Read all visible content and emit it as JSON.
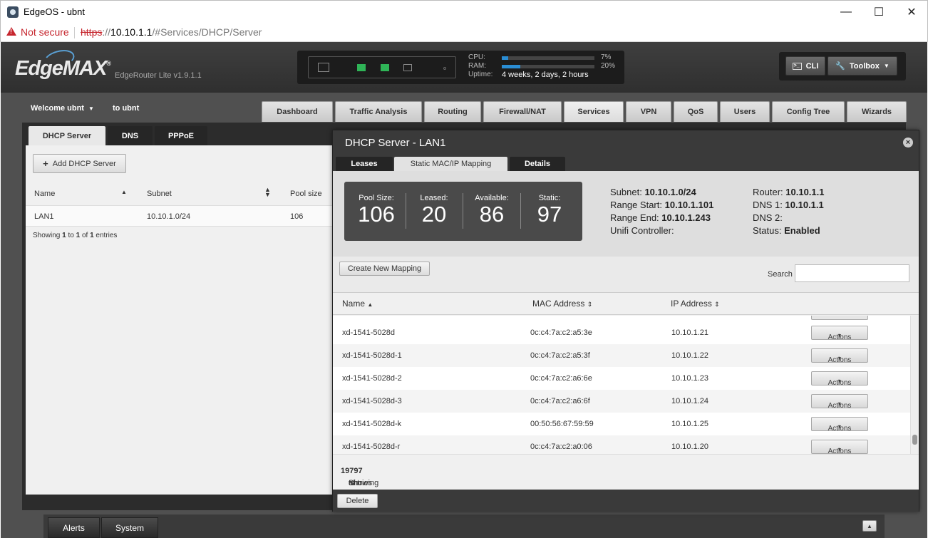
{
  "browser": {
    "window_title": "EdgeOS - ubnt",
    "security_label": "Not secure",
    "url_scheme": "https",
    "url_sep": "://",
    "url_host": "10.10.1.1",
    "url_path": "/#Services/DHCP/Server"
  },
  "header": {
    "logo_text": "EdgeMAX",
    "logo_mark": "®",
    "model": "EdgeRouter Lite v1.9.1.1",
    "cpu_label": "CPU:",
    "cpu_pct": "7%",
    "cpu_value": 7,
    "ram_label": "RAM:",
    "ram_pct": "20%",
    "ram_value": 20,
    "uptime_label": "Uptime:",
    "uptime_value": "4 weeks, 2 days, 2 hours",
    "cli_label": "CLI",
    "toolbox_label": "Toolbox"
  },
  "user": {
    "welcome": "Welcome ubnt",
    "to_ubnt": "to ubnt"
  },
  "nav_tabs": [
    "Dashboard",
    "Traffic Analysis",
    "Routing",
    "Firewall/NAT",
    "Services",
    "VPN",
    "QoS",
    "Users",
    "Config Tree",
    "Wizards"
  ],
  "nav_active": "Services",
  "left": {
    "tabs": [
      "DHCP Server",
      "DNS",
      "PPPoE"
    ],
    "add_button": "Add DHCP Server",
    "col_name": "Name",
    "col_subnet": "Subnet",
    "col_pool": "Pool size",
    "row_name": "LAN1",
    "row_subnet": "10.10.1.0/24",
    "row_pool": "106",
    "info_prefix": "Showing ",
    "info_from": "1",
    "info_to_word": " to ",
    "info_to": "1",
    "info_of_word": " of ",
    "info_total": "1",
    "info_suffix": " entries"
  },
  "modal": {
    "title": "DHCP Server - LAN1",
    "close_glyph": "×",
    "tabs": [
      "Leases",
      "Static MAC/IP Mapping",
      "Details"
    ],
    "active_tab": "Static MAC/IP Mapping",
    "pool_label": "Pool Size:",
    "pool_value": "106",
    "leased_label": "Leased:",
    "leased_value": "20",
    "available_label": "Available:",
    "available_value": "86",
    "static_label": "Static:",
    "static_value": "97",
    "subnet_label": "Subnet:",
    "subnet_value": "10.10.1.0/24",
    "range_start_label": "Range Start:",
    "range_start_value": "10.10.1.101",
    "range_end_label": "Range End:",
    "range_end_value": "10.10.1.243",
    "unifi_label": "Unifi Controller:",
    "router_label": "Router:",
    "router_value": "10.10.1.1",
    "dns1_label": "DNS 1:",
    "dns1_value": "10.10.1.1",
    "dns2_label": "DNS 2:",
    "status_label": "Status:",
    "status_value": "Enabled",
    "create_button": "Create New Mapping",
    "search_label": "Search",
    "search_value": "",
    "col_name": "Name",
    "col_mac": "MAC Address",
    "col_ip": "IP Address",
    "rows": [
      {
        "name": "xd-1541-5028d",
        "mac": "0c:c4:7a:c2:a5:3e",
        "ip": "10.10.1.21",
        "action": "Actions"
      },
      {
        "name": "xd-1541-5028d-1",
        "mac": "0c:c4:7a:c2:a5:3f",
        "ip": "10.10.1.22",
        "action": "Actions"
      },
      {
        "name": "xd-1541-5028d-2",
        "mac": "0c:c4:7a:c2:a6:6e",
        "ip": "10.10.1.23",
        "action": "Actions"
      },
      {
        "name": "xd-1541-5028d-3",
        "mac": "0c:c4:7a:c2:a6:6f",
        "ip": "10.10.1.24",
        "action": "Actions"
      },
      {
        "name": "xd-1541-5028d-k",
        "mac": "00:50:56:67:59:59",
        "ip": "10.10.1.25",
        "action": "Actions"
      },
      {
        "name": "xd-1541-5028d-r",
        "mac": "0c:c4:7a:c2:a0:06",
        "ip": "10.10.1.20",
        "action": "Actions"
      }
    ],
    "info_prefix": "Showing ",
    "info_from": "1",
    "info_to_word": " to ",
    "info_to": "97",
    "info_of_word": " of ",
    "info_total": "97",
    "info_suffix": " entries",
    "delete_button": "Delete"
  },
  "bottom": {
    "alerts": "Alerts",
    "system": "System"
  },
  "colors": {
    "accent_blue": "#2a8dd4",
    "port_green": "#2fb457",
    "warning_red": "#c6262e"
  }
}
